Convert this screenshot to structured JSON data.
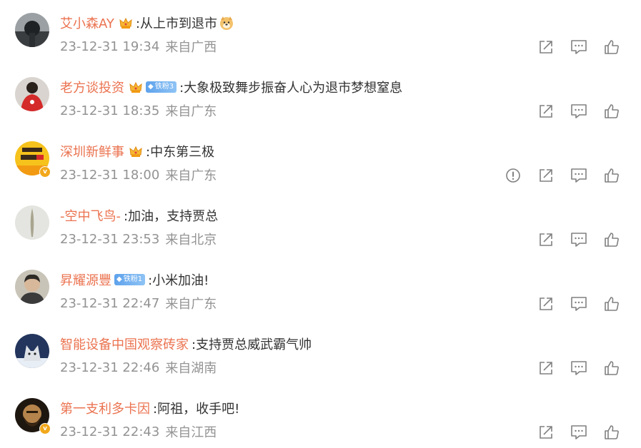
{
  "comments": [
    {
      "user": "艾小森AY",
      "text": ":从上市到退市",
      "time": "23-12-31 19:34",
      "source": "来自广西",
      "crown": true,
      "fan": "",
      "emoji": "doge",
      "verified": false,
      "report": false,
      "avatar": "avatar-1"
    },
    {
      "user": "老方谈投资",
      "text": ":大象极致舞步振奋人心为退市梦想窒息",
      "time": "23-12-31 18:35",
      "source": "来自广东",
      "crown": true,
      "fan": "铁粉3",
      "emoji": "",
      "verified": false,
      "report": false,
      "avatar": "avatar-2"
    },
    {
      "user": "深圳新鲜事",
      "text": ":中东第三极",
      "time": "23-12-31 18:00",
      "source": "来自广东",
      "crown": true,
      "fan": "",
      "emoji": "",
      "verified": true,
      "report": true,
      "avatar": "avatar-3"
    },
    {
      "user": "-空中飞鸟-",
      "text": ":加油，支持贾总",
      "time": "23-12-31 23:53",
      "source": "来自北京",
      "crown": false,
      "fan": "",
      "emoji": "",
      "verified": false,
      "report": false,
      "avatar": "avatar-4"
    },
    {
      "user": "昇耀源豐",
      "text": ":小米加油!",
      "time": "23-12-31 22:47",
      "source": "来自广东",
      "crown": false,
      "fan": "铁粉1",
      "emoji": "",
      "verified": false,
      "report": false,
      "avatar": "avatar-5"
    },
    {
      "user": "智能设备中国观察砖家",
      "text": ":支持贾总威武霸气帅",
      "time": "23-12-31 22:46",
      "source": "来自湖南",
      "crown": false,
      "fan": "",
      "emoji": "",
      "verified": false,
      "report": false,
      "avatar": "avatar-6"
    },
    {
      "user": "第一支利多卡因",
      "text": ":阿祖，收手吧!",
      "time": "23-12-31 22:43",
      "source": "来自江西",
      "crown": false,
      "fan": "",
      "emoji": "",
      "verified": true,
      "report": false,
      "avatar": "avatar-7"
    }
  ],
  "avatar_badge": "v",
  "colors": {
    "username": "#eb7350",
    "text": "#333333",
    "meta": "#939393",
    "icon": "#808080"
  },
  "icons": [
    "report-icon",
    "share-icon",
    "comment-icon",
    "like-icon"
  ]
}
